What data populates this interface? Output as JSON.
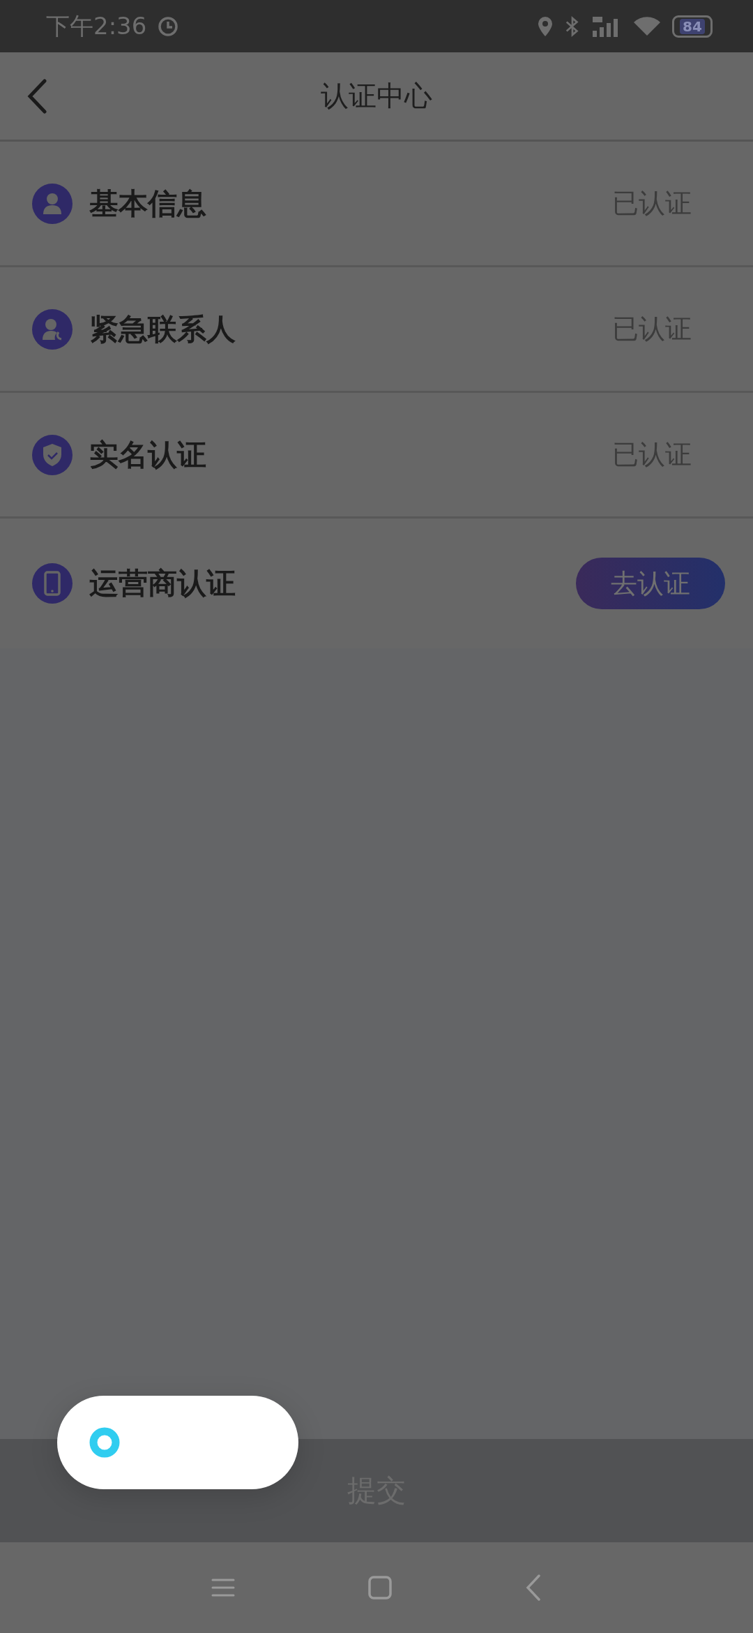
{
  "status_bar": {
    "time": "下午2:36",
    "battery": "84"
  },
  "header": {
    "title": "认证中心"
  },
  "items": [
    {
      "kind": "person",
      "title": "基本信息",
      "action": {
        "kind": "label",
        "text": "已认证"
      }
    },
    {
      "kind": "contact",
      "title": "紧急联系人",
      "action": {
        "kind": "label",
        "text": "已认证"
      }
    },
    {
      "kind": "shield",
      "title": "实名认证",
      "action": {
        "kind": "label",
        "text": "已认证"
      }
    },
    {
      "kind": "phone",
      "title": "运营商认证",
      "action": {
        "kind": "button",
        "text": "去认证"
      }
    }
  ],
  "submit_button": "提交"
}
